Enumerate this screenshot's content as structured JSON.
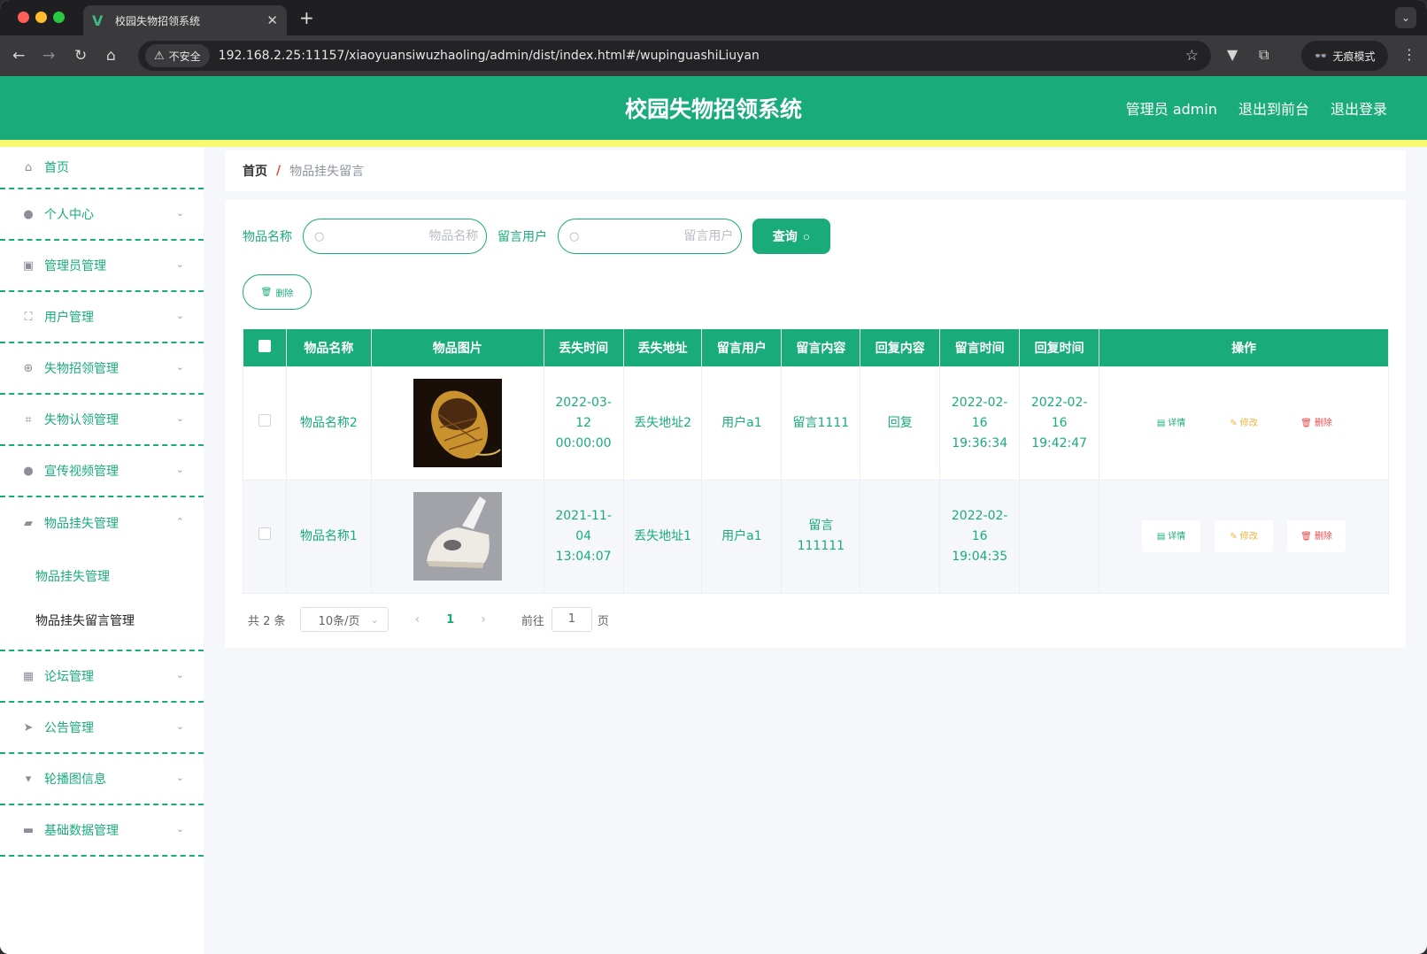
{
  "browser": {
    "tab_title": "校园失物招领系统",
    "tab_favicon": "V",
    "security_label": "不安全",
    "url": "192.168.2.25:11157/xiaoyuansiwuzhaoling/admin/dist/index.html#/wupinguashiLiuyan",
    "incognito_label": "无痕模式"
  },
  "header": {
    "title": "校园失物招领系统",
    "user_label": "管理员 admin",
    "to_front_label": "退出到前台",
    "logout_label": "退出登录",
    "accent_color": "#1aab7b",
    "stripe_color": "#f9f871"
  },
  "sidebar": {
    "items": [
      {
        "label": "首页",
        "icon": "home-icon"
      },
      {
        "label": "个人中心",
        "icon": "user-icon"
      },
      {
        "label": "管理员管理",
        "icon": "clipboard-icon"
      },
      {
        "label": "用户管理",
        "icon": "fullscreen-icon"
      },
      {
        "label": "失物招领管理",
        "icon": "globe-icon"
      },
      {
        "label": "失物认领管理",
        "icon": "crop-icon"
      },
      {
        "label": "宣传视频管理",
        "icon": "user-icon"
      },
      {
        "label": "物品挂失管理",
        "icon": "briefcase-icon"
      },
      {
        "label": "论坛管理",
        "icon": "grid-icon"
      },
      {
        "label": "公告管理",
        "icon": "send-icon"
      },
      {
        "label": "轮播图信息",
        "icon": "signpost-icon"
      },
      {
        "label": "基础数据管理",
        "icon": "ticket-icon"
      }
    ],
    "sub_items": [
      "物品挂失管理",
      "物品挂失留言管理"
    ]
  },
  "breadcrumb": {
    "home": "首页",
    "separator": "/",
    "current": "物品挂失留言"
  },
  "search": {
    "name_label": "物品名称",
    "name_placeholder": "物品名称",
    "user_label": "留言用户",
    "user_placeholder": "留言用户",
    "query_label": "查询"
  },
  "actions": {
    "delete_label": "删除"
  },
  "table": {
    "headers": [
      "物品名称",
      "物品图片",
      "丢失时间",
      "丢失地址",
      "留言用户",
      "留言内容",
      "回复内容",
      "留言时间",
      "回复时间",
      "操作"
    ],
    "rows": [
      {
        "name": "物品名称2",
        "image": "basket",
        "lost_time": "2022-03-12 00:00:00",
        "lost_address": "丢失地址2",
        "user": "用户a1",
        "content": "留言1111",
        "reply": "回复",
        "message_time": "2022-02-16 19:36:34",
        "reply_time": "2022-02-16 19:42:47"
      },
      {
        "name": "物品名称1",
        "image": "iron",
        "lost_time": "2021-11-04 13:04:07",
        "lost_address": "丢失地址1",
        "user": "用户a1",
        "content": "留言111111",
        "reply": "",
        "message_time": "2022-02-16 19:04:35",
        "reply_time": ""
      }
    ],
    "op_detail": "详情",
    "op_edit": "修改",
    "op_delete": "删除"
  },
  "pagination": {
    "total_text": "共 2 条",
    "page_size": "10条/页",
    "current_page": "1",
    "goto_label": "前往",
    "goto_value": "1",
    "page_unit": "页"
  }
}
